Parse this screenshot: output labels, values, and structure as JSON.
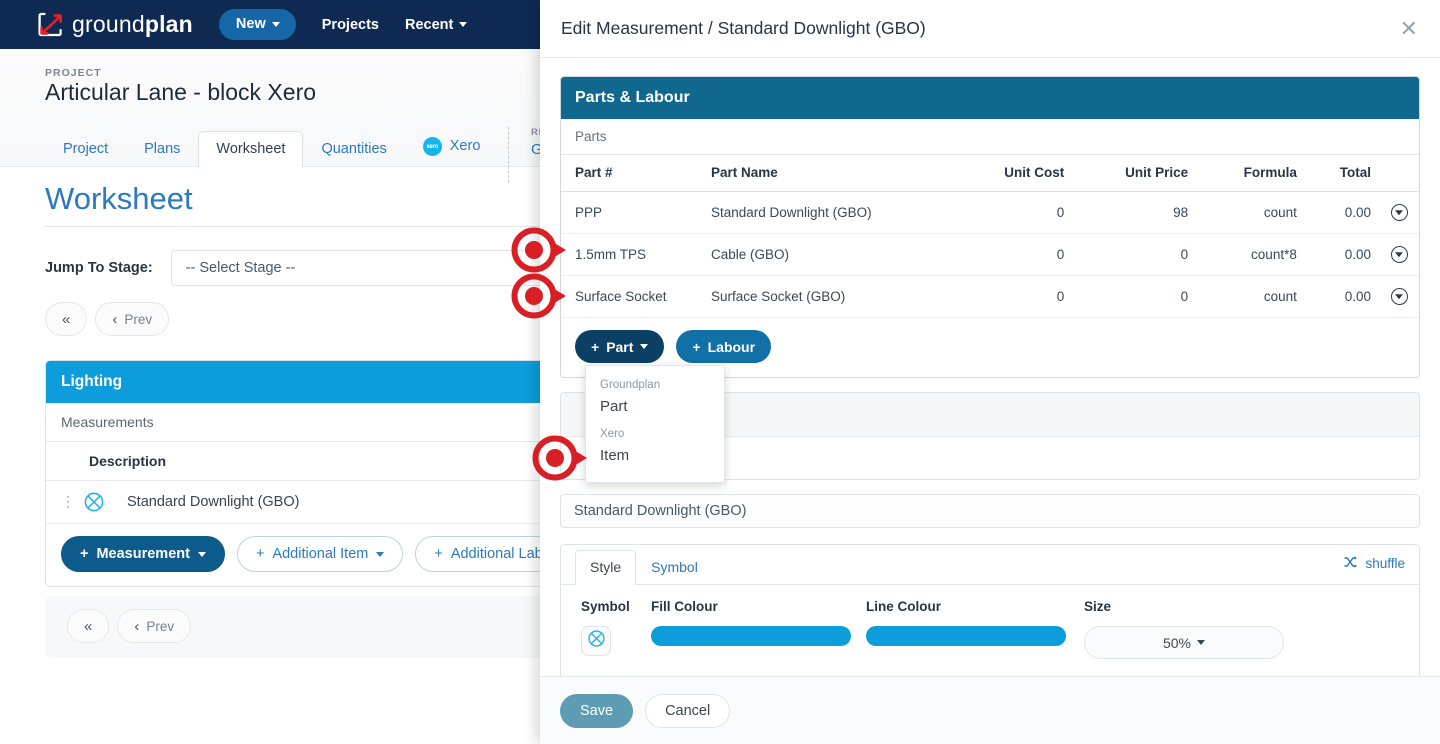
{
  "navbar": {
    "brand_first": "ground",
    "brand_second": "plan",
    "new_label": "New",
    "projects_label": "Projects",
    "recent_label": "Recent",
    "brand_color": "#0e2a53",
    "new_btn_color": "#1667a8"
  },
  "project": {
    "kicker": "PROJECT",
    "title": "Articular Lane - block Xero",
    "tabs": [
      {
        "label": "Project",
        "active": false
      },
      {
        "label": "Plans",
        "active": false
      },
      {
        "label": "Worksheet",
        "active": true
      },
      {
        "label": "Quantities",
        "active": false
      },
      {
        "label": "Xero",
        "active": false,
        "icon": "xero-icon"
      }
    ],
    "retail_kicker": "RET",
    "retail_value": "Gr"
  },
  "worksheet": {
    "page_title": "Worksheet",
    "jump_label": "Jump To Stage:",
    "jump_value": "-- Select Stage --",
    "pager": {
      "first": "«",
      "prev_chevron": "‹",
      "prev_label": "Prev"
    },
    "card": {
      "title": "Lighting",
      "subtitle": "Measurements",
      "column_header": "Description",
      "rows": [
        {
          "symbol": "downlight-symbol-icon",
          "description": "Standard Downlight (GBO)"
        }
      ],
      "actions": [
        {
          "label": "Measurement",
          "style": "primary",
          "caret": true
        },
        {
          "label": "Additional Item",
          "style": "outline",
          "caret": true
        },
        {
          "label": "Additional Labour",
          "style": "outline",
          "caret": false
        }
      ]
    }
  },
  "modal": {
    "title": "Edit Measurement / Standard Downlight (GBO)",
    "close_label": "✕",
    "parts_panel": {
      "heading": "Parts & Labour",
      "heading_color": "#10688f",
      "section_label": "Parts",
      "columns": [
        "Part #",
        "Part Name",
        "Unit Cost",
        "Unit Price",
        "Formula",
        "Total"
      ],
      "rows": [
        {
          "part_no": "PPP",
          "part_name": "Standard Downlight (GBO)",
          "unit_cost": "0",
          "unit_price": "98",
          "formula": "count",
          "total": "0.00",
          "action_icon": "chevron-down-circle-icon"
        },
        {
          "part_no": "1.5mm TPS",
          "part_name": "Cable (GBO)",
          "unit_cost": "0",
          "unit_price": "0",
          "formula": "count*8",
          "total": "0.00",
          "action_icon": "chevron-down-circle-icon"
        },
        {
          "part_no": "Surface Socket",
          "part_name": "Surface Socket (GBO)",
          "unit_cost": "0",
          "unit_price": "0",
          "formula": "count",
          "total": "0.00",
          "action_icon": "chevron-down-circle-icon"
        }
      ],
      "add_part_label": "Part",
      "add_labour_label": "Labour"
    },
    "add_part_dropdown": {
      "group_one": "Groundplan",
      "item_one": "Part",
      "group_two": "Xero",
      "item_two": "Item"
    },
    "name_value": "Standard Downlight (GBO)",
    "style_card": {
      "tabs": [
        {
          "label": "Style",
          "active": true
        },
        {
          "label": "Symbol",
          "active": false
        }
      ],
      "shuffle_label": "shuffle",
      "fields": {
        "symbol_label": "Symbol",
        "fill_label": "Fill Colour",
        "line_label": "Line Colour",
        "size_label": "Size",
        "symbol_icon": "downlight-symbol-icon",
        "fill_colour": "#0d9ddb",
        "line_colour": "#0d9ddb",
        "size_value": "50%"
      }
    },
    "footer": {
      "save_label": "Save",
      "cancel_label": "Cancel",
      "save_color": "#5d9cb2"
    }
  },
  "annotations": {
    "marker_color": "#d81f26",
    "markers": [
      {
        "name": "marker-jump-stage"
      },
      {
        "name": "marker-pager"
      },
      {
        "name": "marker-xero-item"
      }
    ]
  }
}
